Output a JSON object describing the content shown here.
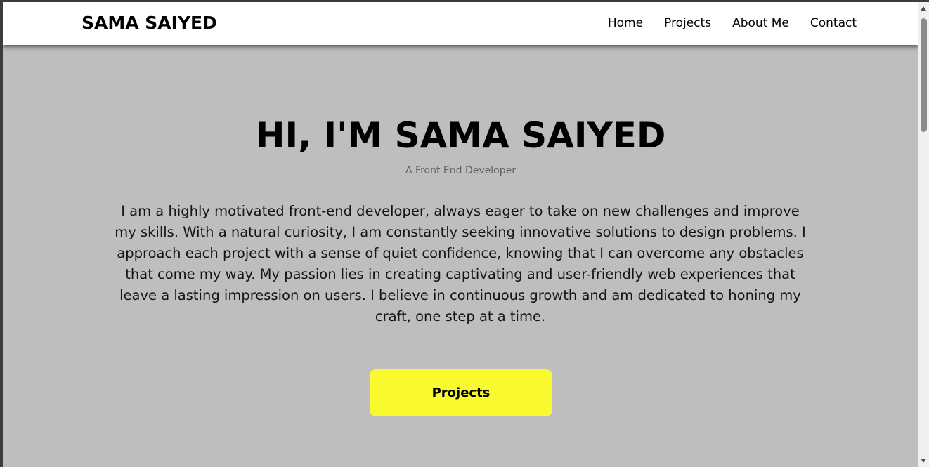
{
  "navbar": {
    "brand": "SAMA SAIYED",
    "links": [
      {
        "label": "Home"
      },
      {
        "label": "Projects"
      },
      {
        "label": "About Me"
      },
      {
        "label": "Contact"
      }
    ]
  },
  "hero": {
    "title": "HI, I'M SAMA SAIYED",
    "subtitle": "A Front End Developer",
    "description": "I am a highly motivated front-end developer, always eager to take on new challenges and improve my skills. With a natural curiosity, I am constantly seeking innovative solutions to design problems. I approach each project with a sense of quiet confidence, knowing that I can overcome any obstacles that come my way. My passion lies in creating captivating and user-friendly web experiences that leave a lasting impression on users. I believe in continuous growth and am dedicated to honing my craft, one step at a time.",
    "button_label": "Projects"
  },
  "colors": {
    "navbar_bg": "#ffffff",
    "hero_bg": "#bebebe",
    "button_bg": "#f9f930",
    "subtitle_text": "#606060"
  }
}
